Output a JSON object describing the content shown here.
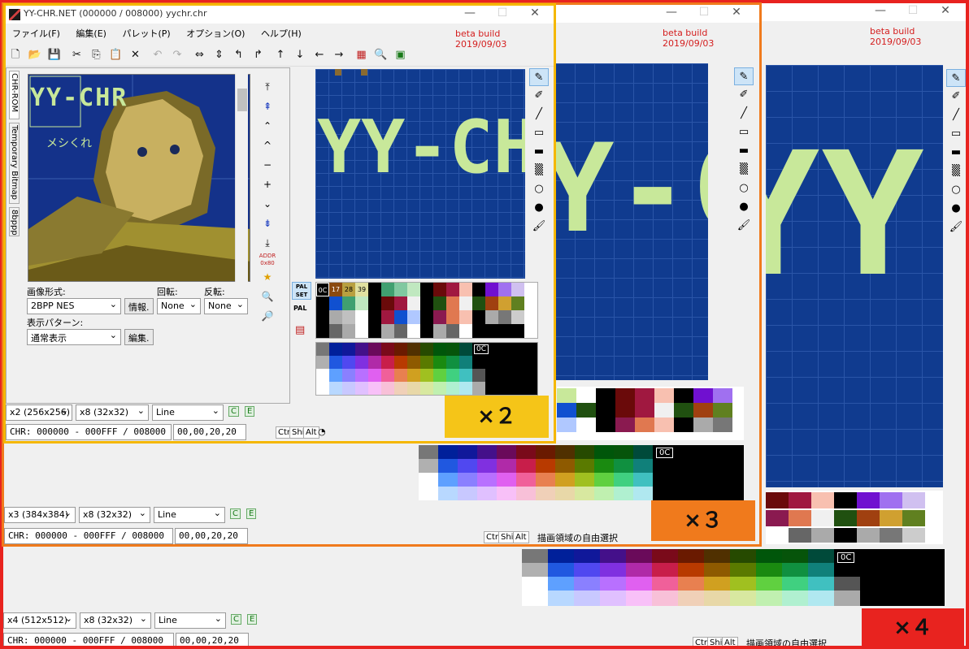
{
  "window": {
    "title": "YY-CHR.NET (000000 / 008000) yychr.chr",
    "beta": "beta build 2019/09/03",
    "controls": [
      "—",
      "☐",
      "✕"
    ]
  },
  "menu": [
    "ファイル(F)",
    "編集(E)",
    "パレット(P)",
    "オプション(O)",
    "ヘルプ(H)"
  ],
  "toolbar_icons": [
    "new-file-icon",
    "open-folder-icon",
    "save-icon",
    "cut-icon",
    "copy-icon",
    "paste-icon",
    "delete-icon",
    "undo-icon",
    "redo-icon",
    "flip-horizontal-icon",
    "flip-vertical-icon",
    "rotate-left-icon",
    "rotate-right-icon",
    "shift-up-icon",
    "shift-down-icon",
    "shift-left-icon",
    "shift-right-icon",
    "palette-edit-icon",
    "properties-icon",
    "save-bitmap-icon"
  ],
  "left_panel": {
    "tabs": [
      "CHR-ROM",
      "Temporary Bitmap",
      "8bppp"
    ],
    "logo_text": "YY-CHR",
    "sub_text": "メシくれ",
    "image_format_label": "画像形式:",
    "image_format_value": "2BPP NES",
    "info_button": "情報.",
    "rotate_label": "回転:",
    "rotate_value": "None",
    "flip_label": "反転:",
    "flip_value": "None",
    "display_pattern_label": "表示パターン:",
    "display_pattern_value": "通常表示",
    "edit_button": "編集.",
    "addr_label": "ADDR",
    "addr_value": "0x80"
  },
  "pal": {
    "set_label": "PAL SET",
    "pal_label": "PAL",
    "indices": [
      "0C",
      "17",
      "28",
      "39"
    ],
    "sel_label": "0C"
  },
  "tools": [
    "pen-icon",
    "pen-thin-icon",
    "line-icon",
    "rect-icon",
    "rect-fill-icon",
    "pattern-fill-icon",
    "circle-icon",
    "circle-fill-icon",
    "bucket-fill-icon"
  ],
  "editor_text": "YY-CHR",
  "views": {
    "x2": {
      "zoom": "x2 (256x256)",
      "grid": "x8 (32x32)",
      "line": "Line",
      "chr": "CHR: 000000 - 000FFF / 008000",
      "coords": "00,00,20,20",
      "badge": "×２"
    },
    "x3": {
      "zoom": "x3 (384x384)",
      "grid": "x8 (32x32)",
      "line": "Line",
      "chr": "CHR: 000000 - 000FFF / 008000",
      "coords": "00,00,20,20",
      "badge": "×３",
      "status": "描画領域の自由選択"
    },
    "x4": {
      "zoom": "x4 (512x512)",
      "grid": "x8 (32x32)",
      "line": "Line",
      "chr": "CHR: 000000 - 000FFF / 008000",
      "coords": "00,00,20,20",
      "badge": "×４",
      "status": "描画領域の自由選択"
    }
  },
  "status_keys": [
    "Ctrl",
    "Shift",
    "Alt"
  ],
  "palette_grid_label": "0C",
  "colors": {
    "border_x4": "#e8231f",
    "border_x3": "#f07a1c",
    "border_x2": "#f5b700",
    "grid_bg": "#103b8f",
    "sprite": "#c8e89a",
    "beta_text": "#d41e1e"
  }
}
